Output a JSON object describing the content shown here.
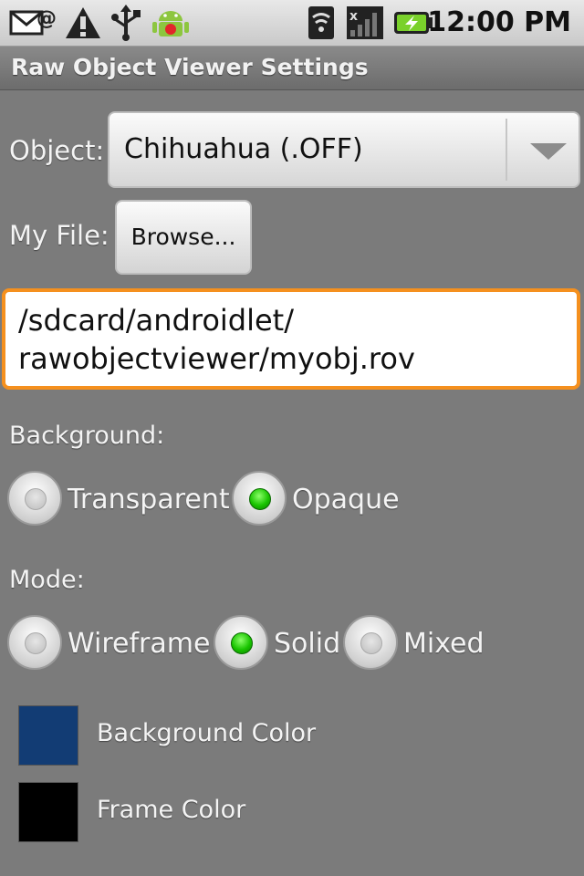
{
  "statusbar": {
    "icons": [
      "email-notification-icon",
      "warning-icon",
      "usb-icon",
      "android-icon",
      "wifi-icon",
      "signal-icon",
      "battery-charging-icon"
    ],
    "time": "12:00 PM"
  },
  "title": "Raw Object Viewer Settings",
  "object": {
    "label": "Object:",
    "selected": "Chihuahua (.OFF)"
  },
  "file": {
    "label": "My File:",
    "browse_label": "Browse...",
    "path": "/sdcard/androidlet/\nrawobjectviewer/myobj.rov"
  },
  "background": {
    "label": "Background:",
    "options": [
      {
        "label": "Transparent",
        "checked": false
      },
      {
        "label": "Opaque",
        "checked": true
      }
    ]
  },
  "mode": {
    "label": "Mode:",
    "options": [
      {
        "label": "Wireframe",
        "checked": false
      },
      {
        "label": "Solid",
        "checked": true
      },
      {
        "label": "Mixed",
        "checked": false
      }
    ]
  },
  "colors": {
    "background_color_label": "Background Color",
    "background_color_value": "#123c74",
    "frame_color_label": "Frame Color",
    "frame_color_value": "#000000"
  },
  "accent": "#f5901e"
}
